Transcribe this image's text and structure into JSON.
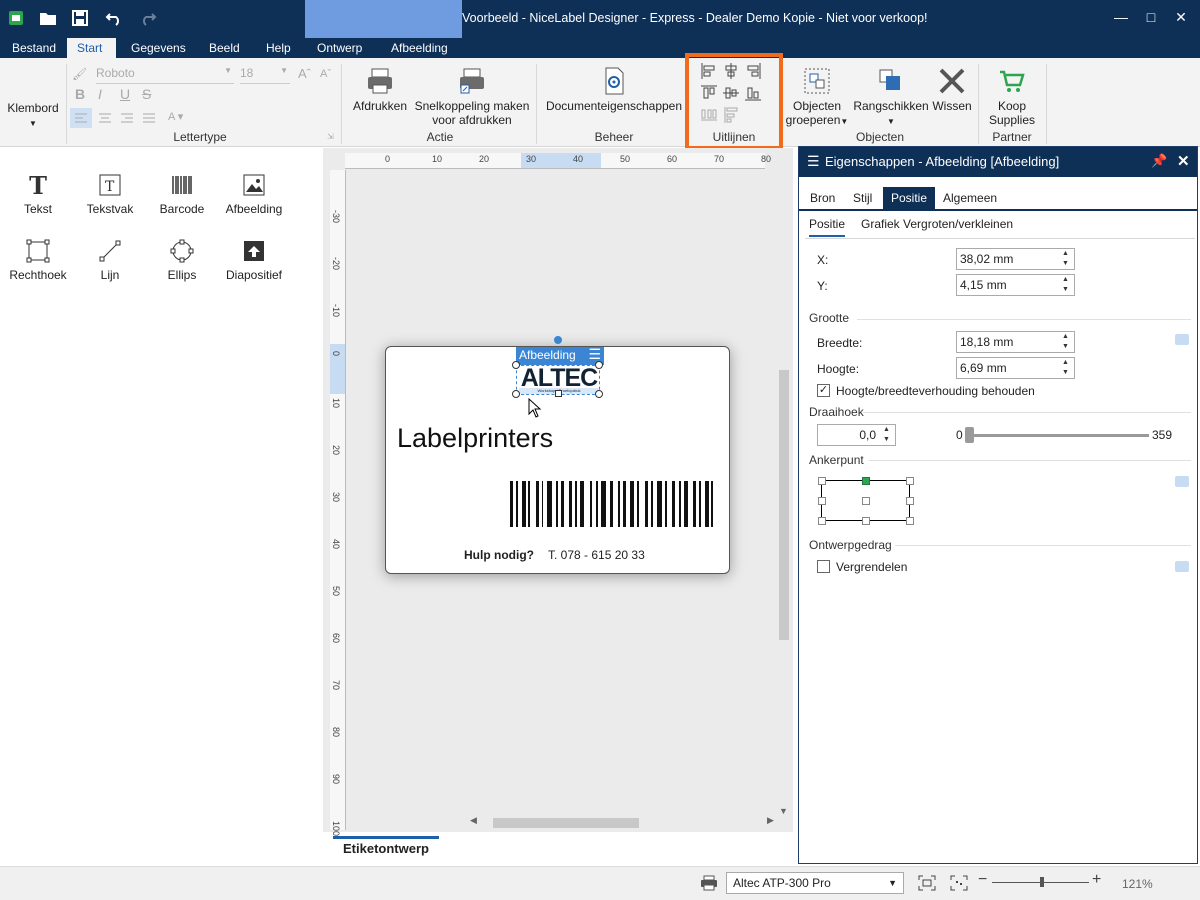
{
  "window": {
    "title": "Voorbeeld - NiceLabel Designer - Express - Dealer Demo Kopie - Niet voor verkoop!",
    "context_group": "Ontwerp"
  },
  "tabs": [
    "Bestand",
    "Start",
    "Gegevens",
    "Beeld",
    "Help",
    "Ontwerp",
    "Afbeelding"
  ],
  "ribbon": {
    "clipboard_label": "Klembord",
    "font": {
      "name": "Roboto",
      "size": "18",
      "group_label": "Lettertype"
    },
    "print": {
      "print_label": "Afdrukken",
      "shortcut_label_1": "Snelkoppeling maken",
      "shortcut_label_2": "voor afdrukken",
      "group_label": "Actie"
    },
    "manage": {
      "doc_props_label": "Documenteigenschappen",
      "group_label": "Beheer"
    },
    "align": {
      "group_label": "Uitlijnen"
    },
    "objects": {
      "group_label_1": "Objecten",
      "group_label_2": "groeperen",
      "arrange_label": "Rangschikken",
      "delete_label": "Wissen",
      "group_label": "Objecten"
    },
    "partner": {
      "label_1": "Koop",
      "label_2": "Supplies",
      "group_label": "Partner"
    }
  },
  "toolbox": [
    {
      "label": "Tekst",
      "icon": "text-icon"
    },
    {
      "label": "Tekstvak",
      "icon": "textbox-icon"
    },
    {
      "label": "Barcode",
      "icon": "barcode-icon"
    },
    {
      "label": "Afbeelding",
      "icon": "image-icon"
    },
    {
      "label": "Rechthoek",
      "icon": "rectangle-icon"
    },
    {
      "label": "Lijn",
      "icon": "line-icon"
    },
    {
      "label": "Ellips",
      "icon": "ellipse-icon"
    },
    {
      "label": "Diapositief",
      "icon": "inverse-icon"
    }
  ],
  "rulers": {
    "horizontal": [
      "0",
      "10",
      "20",
      "30",
      "40",
      "50",
      "60",
      "70",
      "80"
    ],
    "vertical": [
      "-30",
      "-20",
      "-10",
      "0",
      "10",
      "20",
      "30",
      "40",
      "50",
      "60",
      "70",
      "80",
      "90",
      "100"
    ]
  },
  "label": {
    "selection_tag": "Afbeelding",
    "logo_text": "ALTEC",
    "logo_subtext": "Workshop / Proefopdruk",
    "headline": "Labelprinters",
    "help_text": "Hulp nodig?",
    "phone": "T. 078 - 615 20 33"
  },
  "doc_tab": "Etiketontwerp",
  "properties": {
    "title": "Eigenschappen - Afbeelding [Afbeelding]",
    "tabs": [
      "Bron",
      "Stijl",
      "Positie",
      "Algemeen"
    ],
    "subtabs": [
      "Positie",
      "Grafiek Vergroten/verkleinen"
    ],
    "x_label": "X:",
    "x_value": "38,02 mm",
    "y_label": "Y:",
    "y_value": "4,15 mm",
    "size_section": "Grootte",
    "width_label": "Breedte:",
    "width_value": "18,18 mm",
    "height_label": "Hoogte:",
    "height_value": "6,69 mm",
    "keep_ratio_label": "Hoogte/breedteverhouding behouden",
    "keep_ratio_checked": true,
    "rotation_section": "Draaihoek",
    "rotation_value": "0,0",
    "slider_min": "0",
    "slider_max": "359",
    "anchor_section": "Ankerpunt",
    "behavior_section": "Ontwerpgedrag",
    "lock_label": "Vergrendelen",
    "lock_checked": false
  },
  "status": {
    "printer": "Altec ATP-300 Pro",
    "zoom": "121%"
  },
  "colors": {
    "titlebar": "#0e2f56",
    "accent": "#1f5fa8",
    "context_tab": "#6f9be0",
    "highlight": "#f26a1b"
  }
}
